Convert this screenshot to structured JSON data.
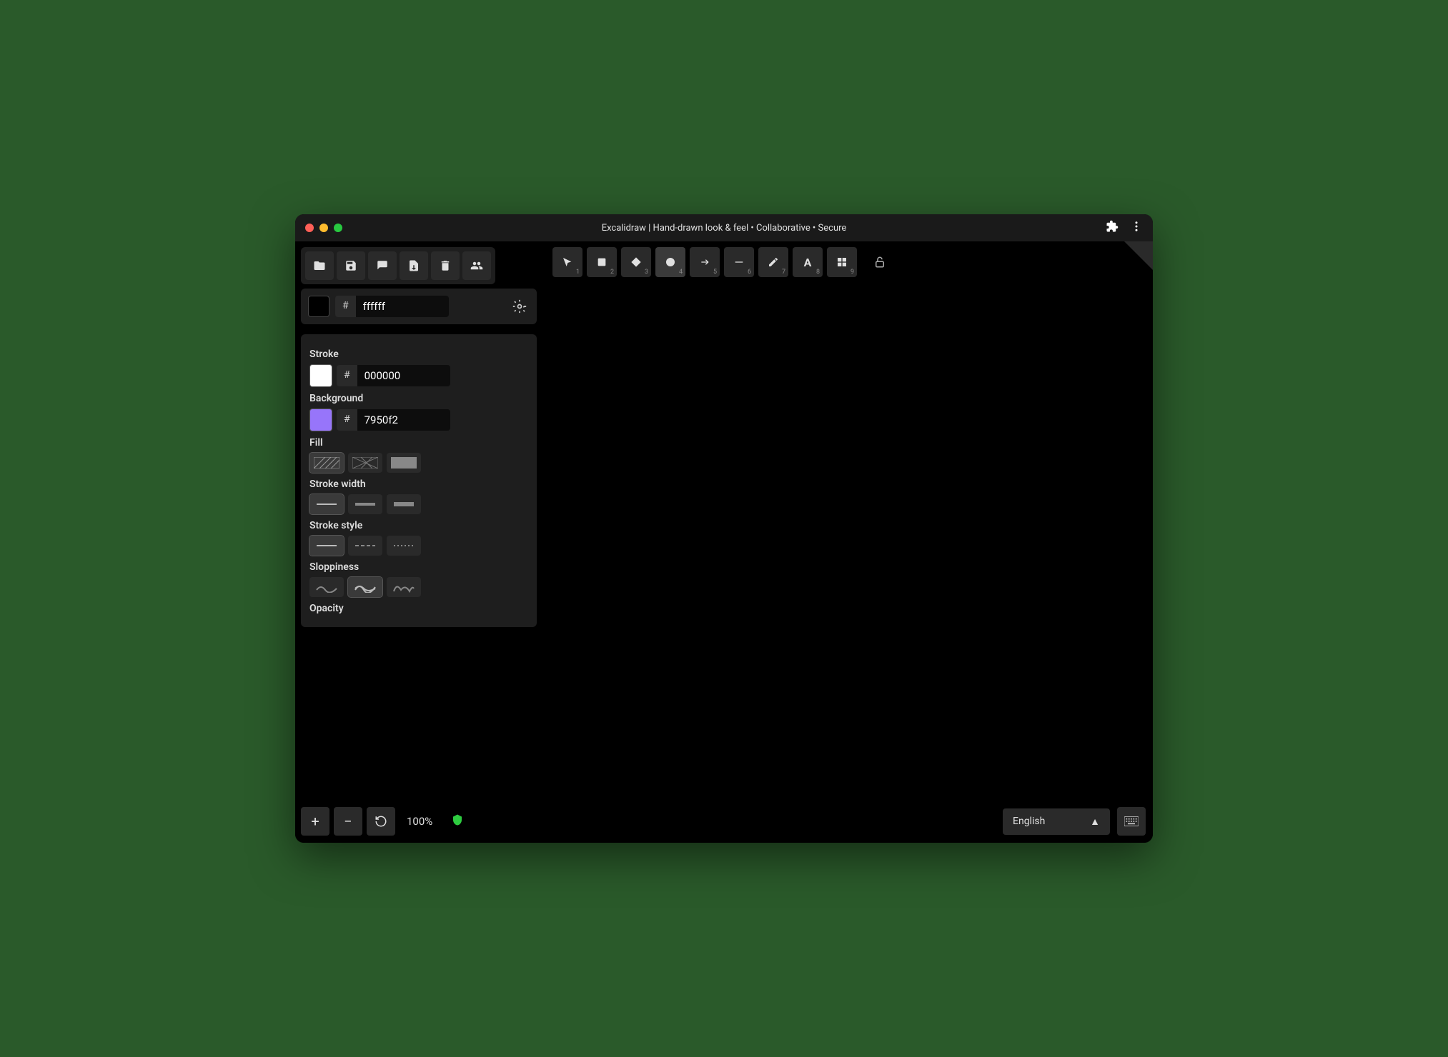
{
  "window": {
    "title": "Excalidraw | Hand-drawn look & feel • Collaborative • Secure"
  },
  "canvas_color": {
    "hash": "#",
    "value": "ffffff"
  },
  "tools": [
    {
      "name": "select",
      "num": "1"
    },
    {
      "name": "rectangle",
      "num": "2"
    },
    {
      "name": "diamond",
      "num": "3"
    },
    {
      "name": "ellipse",
      "num": "4"
    },
    {
      "name": "arrow",
      "num": "5"
    },
    {
      "name": "line",
      "num": "6"
    },
    {
      "name": "draw",
      "num": "7"
    },
    {
      "name": "text",
      "num": "8"
    },
    {
      "name": "grid",
      "num": "9"
    }
  ],
  "side": {
    "stroke": {
      "label": "Stroke",
      "hash": "#",
      "value": "000000",
      "swatch": "#ffffff"
    },
    "background": {
      "label": "Background",
      "hash": "#",
      "value": "7950f2",
      "swatch": "#7950f2"
    },
    "fill": {
      "label": "Fill",
      "options": [
        "hachure",
        "cross",
        "solid"
      ]
    },
    "stroke_width": {
      "label": "Stroke width",
      "options": [
        "thin",
        "medium",
        "thick"
      ]
    },
    "stroke_style": {
      "label": "Stroke style",
      "options": [
        "solid",
        "dashed",
        "dotted"
      ]
    },
    "sloppiness": {
      "label": "Sloppiness",
      "options": [
        "architect",
        "artist",
        "cartoonist"
      ]
    },
    "opacity": {
      "label": "Opacity"
    }
  },
  "zoom": {
    "value": "100%"
  },
  "language": {
    "value": "English"
  }
}
